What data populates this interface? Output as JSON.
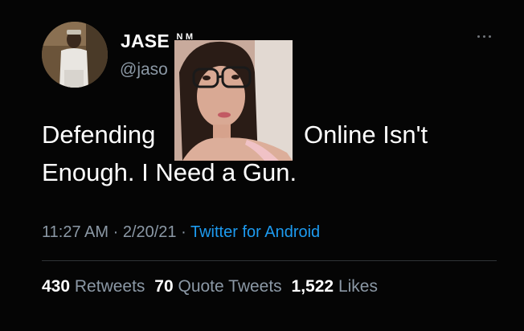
{
  "tweet": {
    "author_name": "JASE",
    "author_name_partial": "N M",
    "author_handle": "@jaso",
    "text_line1_before": "Defending",
    "text_line1_after": "Online Isn't",
    "text_line2": "Enough. I Need a Gun.",
    "time": "11:27 AM",
    "separator": "·",
    "date": "2/20/21",
    "source": "Twitter for Android"
  },
  "stats": {
    "retweets_count": "430",
    "retweets_label": "Retweets",
    "quotes_count": "70",
    "quotes_label": "Quote Tweets",
    "likes_count": "1,522",
    "likes_label": "Likes"
  },
  "icons": {
    "more": "more-horizontal-icon"
  },
  "colors": {
    "background": "#000000",
    "primary_text": "#ffffff",
    "secondary_text": "#8b98a5",
    "link": "#1d9bf0",
    "divider": "#2f3336"
  }
}
